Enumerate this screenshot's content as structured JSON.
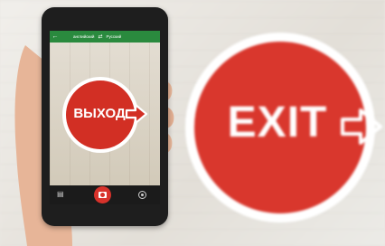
{
  "background_sign": {
    "text": "EXIT",
    "color": "#d9372d"
  },
  "phone": {
    "app_bar": {
      "back_icon": "arrow-left-icon",
      "source_language": "английский",
      "swap_icon": "swap-arrows-icon",
      "target_language": "Русский",
      "color": "#2a8a3e"
    },
    "viewfinder_sign": {
      "text": "ВЫХОД",
      "color": "#d22f24"
    },
    "bottom_bar": {
      "gallery_icon": "gallery-icon",
      "shutter_icon": "camera-icon",
      "mode_icon": "mode-icon",
      "shutter_color": "#d8322b"
    }
  }
}
